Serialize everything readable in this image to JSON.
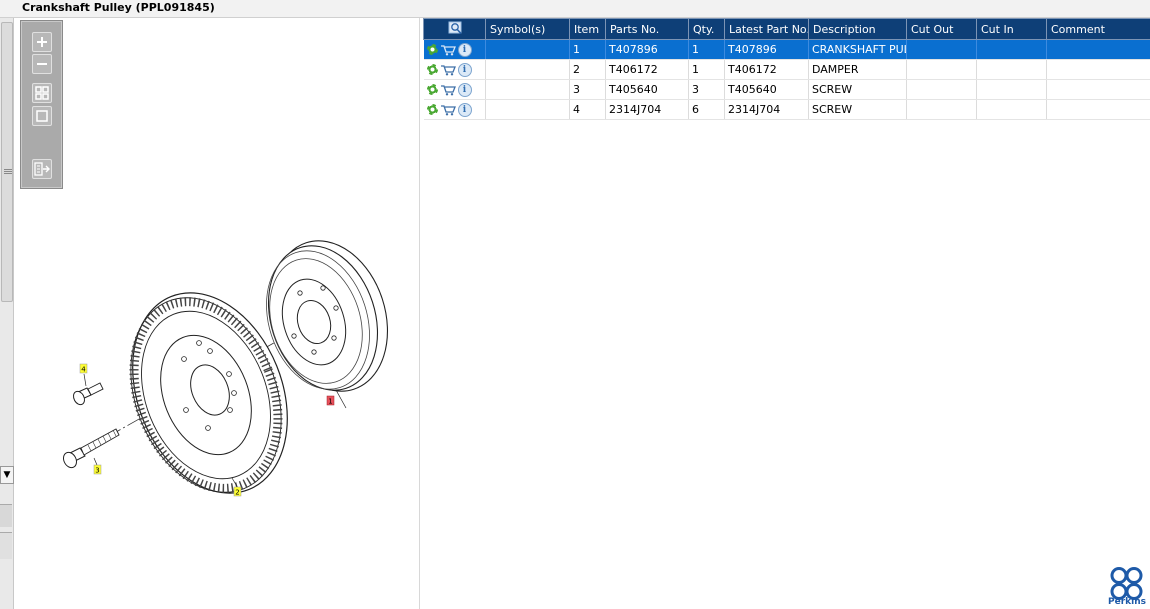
{
  "window": {
    "title": "Crankshaft Pulley (PPL091845)"
  },
  "zoom_toolbar": {
    "tools": [
      {
        "name": "zoom-in",
        "icon": "zoom-in-icon"
      },
      {
        "name": "zoom-out",
        "icon": "zoom-out-icon"
      },
      {
        "name": "fit-all",
        "icon": "fit-all-icon"
      },
      {
        "name": "fit-window",
        "icon": "fit-window-icon"
      },
      {
        "name": "export",
        "icon": "export-icon"
      }
    ]
  },
  "diagram": {
    "callouts": [
      {
        "label": "1",
        "color": "#e8505b"
      },
      {
        "label": "2",
        "color": "#ffff33"
      },
      {
        "label": "3",
        "color": "#ffff33"
      },
      {
        "label": "4",
        "color": "#ffff33"
      }
    ]
  },
  "table": {
    "find_icon": "find-in-drawing-icon",
    "columns": [
      "Symbol(s)",
      "Item",
      "Parts No.",
      "Qty.",
      "Latest Part No.",
      "Description",
      "Cut Out",
      "Cut In",
      "Comment"
    ],
    "rows": [
      {
        "symbol": "",
        "item": "1",
        "part_no": "T407896",
        "qty": "1",
        "latest": "T407896",
        "description": "CRANKSHAFT PULLEY",
        "cut_out": "",
        "cut_in": "",
        "comment": ""
      },
      {
        "symbol": "",
        "item": "2",
        "part_no": "T406172",
        "qty": "1",
        "latest": "T406172",
        "description": "DAMPER",
        "cut_out": "",
        "cut_in": "",
        "comment": ""
      },
      {
        "symbol": "",
        "item": "3",
        "part_no": "T405640",
        "qty": "3",
        "latest": "T405640",
        "description": "SCREW",
        "cut_out": "",
        "cut_in": "",
        "comment": ""
      },
      {
        "symbol": "",
        "item": "4",
        "part_no": "2314J704",
        "qty": "6",
        "latest": "2314J704",
        "description": "SCREW",
        "cut_out": "",
        "cut_in": "",
        "comment": ""
      }
    ],
    "selected_row": 0
  },
  "brand": {
    "name": "Perkins",
    "color": "#1e5aa8"
  },
  "colors": {
    "header_bg": "#0e3f77",
    "selected_row": "#0a6fd0",
    "gear": "#4aa832",
    "cart": "#3d6fa8"
  }
}
